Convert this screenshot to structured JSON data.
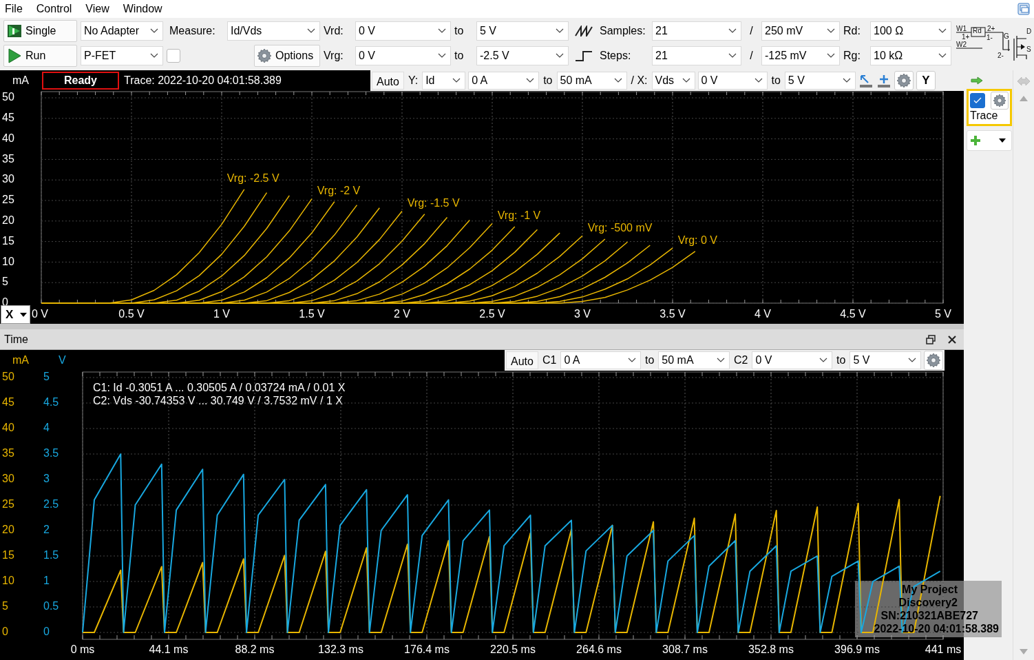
{
  "menu": [
    "File",
    "Control",
    "View",
    "Window"
  ],
  "toolbar": {
    "single_button": "Single",
    "run_button": "Run",
    "adapter": "No Adapter",
    "device": "P-FET",
    "device_option": {
      "checked": false
    },
    "measure_label": "Measure:",
    "measure": "Id/Vds",
    "options_button": "Options",
    "sweeps": [
      {
        "kind": "ramp",
        "label": "Vrd:",
        "from": "0 V",
        "to_label": "to",
        "to": "5 V",
        "count_label": "Samples:",
        "count": "21",
        "separator": "/",
        "step": "250 mV",
        "resistor_label": "Rd:",
        "resistor": "100 Ω"
      },
      {
        "kind": "step",
        "label": "Vrg:",
        "from": "0 V",
        "to_label": "to",
        "to": "-2.5 V",
        "count_label": "Steps:",
        "count": "21",
        "separator": "/",
        "step": "-125 mV",
        "resistor_label": "Rg:",
        "resistor": "10 kΩ"
      }
    ],
    "schematic_labels": [
      "W1",
      "1+",
      "Rd",
      "2+",
      "1-",
      "W2",
      "G",
      "D",
      "S",
      "2-"
    ]
  },
  "upper_plot": {
    "status": "Ready",
    "trace_label": "Trace: 2022-10-20 04:01:58.389",
    "auto_button": "Auto",
    "y_label": "Y:",
    "y_signal": "Id",
    "y_from": "0 A",
    "y_to_label": "to",
    "y_to": "50 mA",
    "x_label": "/ X:",
    "x_signal": "Vds",
    "x_from": "0 V",
    "x_to_label": "to",
    "x_to": "5 V",
    "y_button": "Y",
    "x_button": "X",
    "chart_data": {
      "type": "line",
      "ylabel": "mA",
      "xlim": [
        0,
        5
      ],
      "ylim": [
        0,
        50
      ],
      "xticks": [
        {
          "value": 0,
          "label": "0 V"
        },
        {
          "value": 0.5,
          "label": "0.5 V"
        },
        {
          "value": 1,
          "label": "1 V"
        },
        {
          "value": 1.5,
          "label": "1.5 V"
        },
        {
          "value": 2,
          "label": "2 V"
        },
        {
          "value": 2.5,
          "label": "2.5 V"
        },
        {
          "value": 3,
          "label": "3 V"
        },
        {
          "value": 3.5,
          "label": "3.5 V"
        },
        {
          "value": 4,
          "label": "4 V"
        },
        {
          "value": 4.5,
          "label": "4.5 V"
        },
        {
          "value": 5,
          "label": "5 V"
        }
      ],
      "yticks": [
        0,
        5,
        10,
        15,
        20,
        25,
        30,
        35,
        40,
        45,
        50
      ],
      "x": [
        0,
        0.125,
        0.25,
        0.375,
        0.5,
        0.625,
        0.75,
        0.875,
        1,
        1.125,
        1.25,
        1.375,
        1.5,
        1.625,
        1.75,
        1.875,
        2,
        2.125,
        2.25,
        2.375,
        2.5,
        2.625,
        2.75,
        2.875,
        3,
        3.125,
        3.25,
        3.375,
        3.5,
        3.625
      ],
      "series": [
        {
          "name": "Vrg: -2.5 V",
          "color": "#e8b600",
          "values": [
            0,
            0,
            0,
            0,
            0.8,
            3.1,
            6.9,
            12.3,
            19.2,
            27.7,
            null,
            null,
            null,
            null,
            null,
            null,
            null,
            null,
            null,
            null,
            null,
            null,
            null,
            null,
            null,
            null,
            null,
            null,
            null,
            null
          ]
        },
        {
          "color": "#e8b600",
          "values": [
            0,
            0,
            0,
            0,
            0,
            0.8,
            3.0,
            6.7,
            11.9,
            18.7,
            26.9,
            null,
            null,
            null,
            null,
            null,
            null,
            null,
            null,
            null,
            null,
            null,
            null,
            null,
            null,
            null,
            null,
            null,
            null,
            null
          ]
        },
        {
          "color": "#e8b600",
          "values": [
            0,
            0,
            0,
            0,
            0,
            0,
            0.7,
            2.9,
            6.6,
            11.6,
            18.2,
            26.2,
            null,
            null,
            null,
            null,
            null,
            null,
            null,
            null,
            null,
            null,
            null,
            null,
            null,
            null,
            null,
            null,
            null,
            null
          ]
        },
        {
          "color": "#e8b600",
          "values": [
            0,
            0,
            0,
            0,
            0,
            0,
            0,
            0.7,
            2.8,
            6.4,
            11.3,
            17.6,
            25.4,
            null,
            null,
            null,
            null,
            null,
            null,
            null,
            null,
            null,
            null,
            null,
            null,
            null,
            null,
            null,
            null,
            null
          ]
        },
        {
          "name": "Vrg: -2 V",
          "color": "#e8b600",
          "values": [
            0,
            0,
            0,
            0,
            0,
            0,
            0,
            0,
            0.7,
            2.7,
            6.2,
            11.0,
            17.1,
            24.7,
            null,
            null,
            null,
            null,
            null,
            null,
            null,
            null,
            null,
            null,
            null,
            null,
            null,
            null,
            null,
            null
          ]
        },
        {
          "color": "#e8b600",
          "values": [
            0,
            0,
            0,
            0,
            0,
            0,
            0,
            0,
            0,
            0.7,
            2.7,
            6.0,
            10.6,
            16.6,
            23.9,
            null,
            null,
            null,
            null,
            null,
            null,
            null,
            null,
            null,
            null,
            null,
            null,
            null,
            null,
            null
          ]
        },
        {
          "color": "#e8b600",
          "values": [
            0,
            0,
            0,
            0,
            0,
            0,
            0,
            0,
            0,
            0,
            0.6,
            2.6,
            5.8,
            10.3,
            16.1,
            23.2,
            null,
            null,
            null,
            null,
            null,
            null,
            null,
            null,
            null,
            null,
            null,
            null,
            null,
            null
          ]
        },
        {
          "color": "#e8b600",
          "values": [
            0,
            0,
            0,
            0,
            0,
            0,
            0,
            0,
            0,
            0,
            0,
            0.6,
            2.5,
            5.6,
            9.9,
            15.5,
            22.4,
            null,
            null,
            null,
            null,
            null,
            null,
            null,
            null,
            null,
            null,
            null,
            null,
            null
          ]
        },
        {
          "name": "Vrg: -1.5 V",
          "color": "#e8b600",
          "values": [
            0,
            0,
            0,
            0,
            0,
            0,
            0,
            0,
            0,
            0,
            0,
            0,
            0.6,
            2.4,
            5.4,
            9.6,
            15.1,
            21.7,
            null,
            null,
            null,
            null,
            null,
            null,
            null,
            null,
            null,
            null,
            null,
            null
          ]
        },
        {
          "color": "#e8b600",
          "values": [
            0,
            0,
            0,
            0,
            0,
            0,
            0,
            0,
            0,
            0,
            0,
            0,
            0,
            0.6,
            2.3,
            5.2,
            9.3,
            14.5,
            20.9,
            null,
            null,
            null,
            null,
            null,
            null,
            null,
            null,
            null,
            null,
            null
          ]
        },
        {
          "color": "#e8b600",
          "values": [
            0,
            0,
            0,
            0,
            0,
            0,
            0,
            0,
            0,
            0,
            0,
            0,
            0,
            0,
            0.6,
            2.2,
            5.1,
            9.0,
            14.0,
            20.2,
            null,
            null,
            null,
            null,
            null,
            null,
            null,
            null,
            null,
            null
          ]
        },
        {
          "color": "#e8b600",
          "values": [
            0,
            0,
            0,
            0,
            0,
            0,
            0,
            0,
            0,
            0,
            0,
            0,
            0,
            0,
            0,
            0.5,
            2.2,
            4.9,
            8.6,
            13.5,
            19.4,
            null,
            null,
            null,
            null,
            null,
            null,
            null,
            null,
            null
          ]
        },
        {
          "name": "Vrg: -1 V",
          "color": "#e8b600",
          "values": [
            0,
            0,
            0,
            0,
            0,
            0,
            0,
            0,
            0,
            0,
            0,
            0,
            0,
            0,
            0,
            0,
            0.5,
            2.1,
            4.7,
            8.3,
            12.9,
            18.6,
            null,
            null,
            null,
            null,
            null,
            null,
            null,
            null
          ]
        },
        {
          "color": "#e8b600",
          "values": [
            0,
            0,
            0,
            0,
            0,
            0,
            0,
            0,
            0,
            0,
            0,
            0,
            0,
            0,
            0,
            0,
            0,
            0.5,
            2.0,
            4.5,
            7.9,
            12.4,
            17.9,
            null,
            null,
            null,
            null,
            null,
            null,
            null
          ]
        },
        {
          "color": "#e8b600",
          "values": [
            0,
            0,
            0,
            0,
            0,
            0,
            0,
            0,
            0,
            0,
            0,
            0,
            0,
            0,
            0,
            0,
            0,
            0,
            0.5,
            1.9,
            4.3,
            7.6,
            11.9,
            17.1,
            null,
            null,
            null,
            null,
            null,
            null
          ]
        },
        {
          "color": "#e8b600",
          "values": [
            0,
            0,
            0,
            0,
            0,
            0,
            0,
            0,
            0,
            0,
            0,
            0,
            0,
            0,
            0,
            0,
            0,
            0,
            0,
            0.5,
            1.8,
            4.1,
            7.3,
            11.4,
            16.4,
            null,
            null,
            null,
            null,
            null
          ]
        },
        {
          "name": "Vrg: -500 mV",
          "color": "#e8b600",
          "values": [
            0,
            0,
            0,
            0,
            0,
            0,
            0,
            0,
            0,
            0,
            0,
            0,
            0,
            0,
            0,
            0,
            0,
            0,
            0,
            0,
            0.4,
            1.7,
            3.9,
            6.9,
            10.8,
            15.6,
            null,
            null,
            null,
            null
          ]
        },
        {
          "color": "#e8b600",
          "values": [
            0,
            0,
            0,
            0,
            0,
            0,
            0,
            0,
            0,
            0,
            0,
            0,
            0,
            0,
            0,
            0,
            0,
            0,
            0,
            0,
            0,
            0.4,
            1.7,
            3.7,
            6.6,
            10.3,
            14.9,
            null,
            null,
            null
          ]
        },
        {
          "color": "#e8b600",
          "values": [
            0,
            0,
            0,
            0,
            0,
            0,
            0,
            0,
            0,
            0,
            0,
            0,
            0,
            0,
            0,
            0,
            0,
            0,
            0,
            0,
            0,
            0,
            0.4,
            1.6,
            3.5,
            6.3,
            9.8,
            14.1,
            null,
            null
          ]
        },
        {
          "color": "#e8b600",
          "values": [
            0,
            0,
            0,
            0,
            0,
            0,
            0,
            0,
            0,
            0,
            0,
            0,
            0,
            0,
            0,
            0,
            0,
            0,
            0,
            0,
            0,
            0,
            0,
            0.4,
            1.5,
            3.4,
            5.9,
            9.3,
            13.4,
            null
          ]
        },
        {
          "name": "Vrg: 0 V",
          "color": "#e8b600",
          "values": [
            0,
            0,
            0,
            0,
            0,
            0,
            0,
            0,
            0,
            0,
            0,
            0,
            0,
            0,
            0,
            0,
            0,
            0,
            0,
            0,
            0,
            0,
            0,
            0,
            0.4,
            1.4,
            3.2,
            5.6,
            8.7,
            12.6
          ]
        }
      ],
      "grid": true
    }
  },
  "time_plot": {
    "title": "Time",
    "auto_button": "Auto",
    "channels": [
      {
        "from": "0 A",
        "to_label": "to",
        "to": "50 mA"
      },
      {
        "from": "0 V",
        "to_label": "to",
        "to": "5 V"
      }
    ],
    "readouts": [
      "C1: Id -0.3051 A ... 0.30505 A / 0.03724 mA / 0.01 X",
      "C2: Vds -30.74353 V ... 30.749 V / 3.7532 mV / 1 X"
    ],
    "device_info": [
      "My Project",
      "Discovery2",
      "SN:210321ABE727",
      "2022-10-20 04:01:58.389"
    ],
    "chart_data": {
      "type": "line",
      "ylabel": "mA",
      "y2label": "V",
      "grid": true,
      "xlim": [
        0,
        441
      ],
      "ylim": [
        0,
        50
      ],
      "y2lim": [
        0,
        5
      ],
      "xticks": [
        {
          "value": 0,
          "label": "0 ms"
        },
        {
          "value": 44.1,
          "label": "44.1 ms"
        },
        {
          "value": 88.2,
          "label": "88.2 ms"
        },
        {
          "value": 132.3,
          "label": "132.3 ms"
        },
        {
          "value": 176.4,
          "label": "176.4 ms"
        },
        {
          "value": 220.5,
          "label": "220.5 ms"
        },
        {
          "value": 264.6,
          "label": "264.6 ms"
        },
        {
          "value": 308.7,
          "label": "308.7 ms"
        },
        {
          "value": 352.8,
          "label": "352.8 ms"
        },
        {
          "value": 396.9,
          "label": "396.9 ms"
        },
        {
          "value": 441,
          "label": "441 ms"
        }
      ],
      "yticks": [
        0,
        5,
        10,
        15,
        20,
        25,
        30,
        35,
        40,
        45,
        50
      ],
      "y2ticks": [
        0,
        0.5,
        1,
        1.5,
        2,
        2.5,
        3,
        3.5,
        4,
        4.5,
        5
      ],
      "x": [
        0,
        6,
        19.5,
        21,
        27,
        40.5,
        42,
        48,
        61.5,
        63,
        69,
        82.5,
        84,
        90,
        103.5,
        105,
        111,
        124.5,
        126,
        132,
        145.5,
        147,
        153,
        166.5,
        168,
        174,
        187.5,
        189,
        195,
        208.5,
        210,
        216,
        229.5,
        231,
        237,
        250.5,
        252,
        258,
        271.5,
        273,
        279,
        292.5,
        294,
        300,
        313.5,
        315,
        321,
        334.5,
        336,
        342,
        355.5,
        357,
        363,
        376.5,
        378,
        384,
        397.5,
        399,
        405,
        418.5,
        420,
        426,
        439.5
      ],
      "series": [
        {
          "name": "C1",
          "color": "#e8b600",
          "values": [
            0,
            0,
            12.2,
            0,
            0,
            12.9,
            0,
            0,
            13.7,
            0,
            0,
            14.4,
            0,
            0,
            15.1,
            0,
            0,
            15.9,
            0,
            0,
            16.6,
            0,
            0,
            17.3,
            0,
            0,
            18.0,
            0,
            0,
            18.8,
            0,
            0,
            19.5,
            0,
            0,
            20.2,
            0,
            0,
            21.0,
            0,
            0,
            21.7,
            0,
            0,
            22.4,
            0,
            0,
            23.2,
            0,
            0,
            23.9,
            0,
            0,
            24.6,
            0,
            0,
            25.3,
            0,
            0,
            26.1,
            0,
            0,
            26.8
          ]
        },
        {
          "name": "C2",
          "axis": "y2",
          "color": "#18a8e0",
          "values": [
            0,
            2.6,
            3.5,
            0,
            2.5,
            3.3,
            0,
            2.4,
            3.2,
            0,
            2.3,
            3.1,
            0,
            2.3,
            3.0,
            0,
            2.2,
            2.9,
            0,
            2.1,
            2.8,
            0,
            2.0,
            2.7,
            0,
            1.9,
            2.6,
            0,
            1.8,
            2.4,
            0,
            1.7,
            2.3,
            0,
            1.7,
            2.2,
            0,
            1.6,
            2.1,
            0,
            1.5,
            2.0,
            0,
            1.4,
            1.9,
            0,
            1.3,
            1.8,
            0,
            1.2,
            1.7,
            0,
            1.2,
            1.5,
            0,
            1.1,
            1.4,
            0,
            1.0,
            1.3,
            0,
            0.9,
            1.2
          ]
        }
      ]
    }
  },
  "side_panel": {
    "traces": [
      {
        "label": "Trace",
        "checked": true,
        "selected": true
      }
    ]
  }
}
